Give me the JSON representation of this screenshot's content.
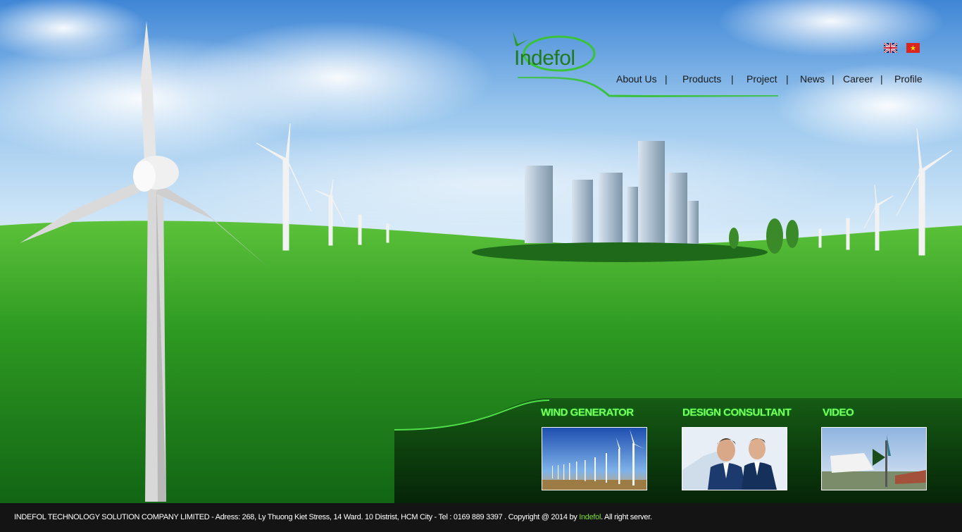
{
  "brand": {
    "logo_text": "Indefol"
  },
  "flags": [
    {
      "name": "English",
      "icon": "uk-flag-icon"
    },
    {
      "name": "Vietnamese",
      "icon": "vn-flag-icon"
    }
  ],
  "nav": {
    "items": [
      "About Us",
      "Products",
      "Project",
      "News",
      "Career",
      "Profile"
    ],
    "separator": "|"
  },
  "sections": [
    {
      "title": "WIND GENERATOR",
      "image_icon": "wind-farm-image"
    },
    {
      "title": "DESIGN CONSULTANT",
      "image_icon": "business-meeting-image"
    },
    {
      "title": "VIDEO",
      "image_icon": "video-thumbnail-image"
    }
  ],
  "footer": {
    "text_before": "INDEFOL TECHNOLOGY SOLUTION COMPANY LIMITED -  Adress: 268,  Ly Thuong Kiet Stress, 14 Ward. 10 Distrist, HCM City  -   Tel :  0169 889 3397  . Copyright @ 2014 by ",
    "brand_link": "Indefol",
    "text_after": ". All right server."
  },
  "colors": {
    "accent_green": "#7dff5a",
    "brand_green": "#1f7a1f",
    "footer_bg": "#141414",
    "footer_link": "#7bdc2c"
  }
}
